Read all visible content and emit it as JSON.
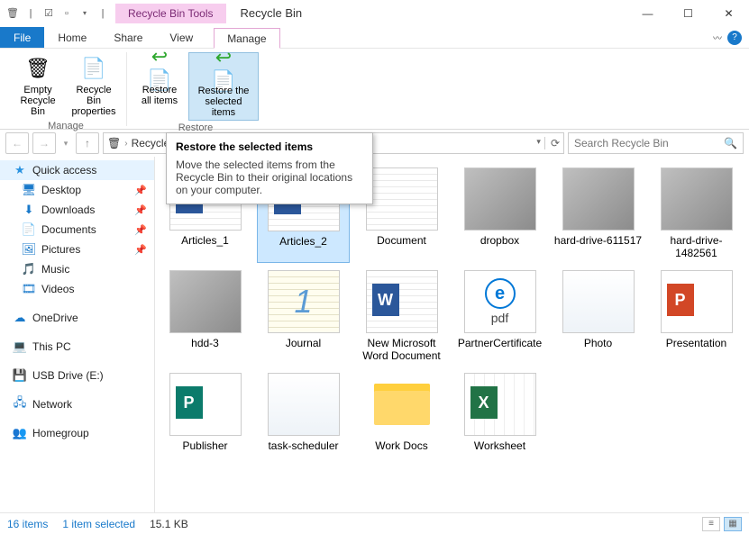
{
  "window": {
    "contextual_tab": "Recycle Bin Tools",
    "title": "Recycle Bin"
  },
  "tabs": {
    "file": "File",
    "home": "Home",
    "share": "Share",
    "view": "View",
    "manage": "Manage"
  },
  "ribbon": {
    "manage_group": "Manage",
    "restore_group": "Restore",
    "empty": "Empty Recycle Bin",
    "properties": "Recycle Bin properties",
    "restore_all": "Restore all items",
    "restore_selected": "Restore the selected items"
  },
  "tooltip": {
    "title": "Restore the selected items",
    "body": "Move the selected items from the Recycle Bin to their original locations on your computer."
  },
  "path": {
    "location": "Recycle"
  },
  "search": {
    "placeholder": "Search Recycle Bin"
  },
  "sidebar": {
    "quick_access": "Quick access",
    "desktop": "Desktop",
    "downloads": "Downloads",
    "documents": "Documents",
    "pictures": "Pictures",
    "music": "Music",
    "videos": "Videos",
    "onedrive": "OneDrive",
    "this_pc": "This PC",
    "usb": "USB Drive (E:)",
    "network": "Network",
    "homegroup": "Homegroup"
  },
  "items": [
    {
      "name": "Articles_1",
      "kind": "word"
    },
    {
      "name": "Articles_2",
      "kind": "word",
      "selected": true
    },
    {
      "name": "Document",
      "kind": "text"
    },
    {
      "name": "dropbox",
      "kind": "image"
    },
    {
      "name": "hard-drive-611517",
      "kind": "image"
    },
    {
      "name": "hard-drive-1482561",
      "kind": "image"
    },
    {
      "name": "hdd-3",
      "kind": "image"
    },
    {
      "name": "Journal",
      "kind": "journal"
    },
    {
      "name": "New Microsoft Word Document",
      "kind": "word"
    },
    {
      "name": "PartnerCertificate",
      "kind": "pdf"
    },
    {
      "name": "Photo",
      "kind": "screenshot"
    },
    {
      "name": "Presentation",
      "kind": "ppt"
    },
    {
      "name": "Publisher",
      "kind": "pub"
    },
    {
      "name": "task-scheduler",
      "kind": "screenshot"
    },
    {
      "name": "Work Docs",
      "kind": "folder"
    },
    {
      "name": "Worksheet",
      "kind": "xls"
    }
  ],
  "status": {
    "count": "16 items",
    "selection": "1 item selected",
    "size": "15.1 KB"
  }
}
